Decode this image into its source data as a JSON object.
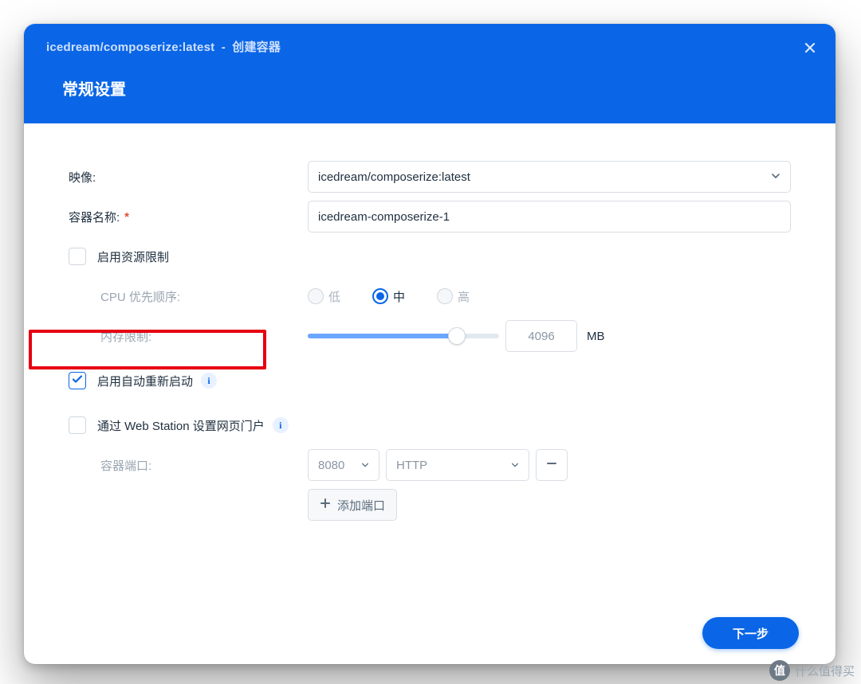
{
  "header": {
    "image_label": "icedream/composerize:latest",
    "separator": "-",
    "action_label": "创建容器",
    "subtitle": "常规设置"
  },
  "form": {
    "image_label": "映像:",
    "image_value": "icedream/composerize:latest",
    "name_label": "容器名称:",
    "name_value": "icedream-composerize-1",
    "enable_limit_label": "启用资源限制",
    "cpu_priority_label": "CPU 优先顺序:",
    "cpu_low": "低",
    "cpu_mid": "中",
    "cpu_high": "高",
    "mem_limit_label": "内存限制:",
    "mem_value": "4096",
    "mem_unit": "MB",
    "auto_restart_label": "启用自动重新启动",
    "webstation_label": "通过 Web Station 设置网页门户",
    "container_port_label": "容器端口:",
    "port_value": "8080",
    "protocol_value": "HTTP",
    "add_port_label": "添加端口"
  },
  "footer": {
    "next_label": "下一步"
  },
  "watermark": {
    "text": "什么值得买",
    "glyph": "值"
  }
}
